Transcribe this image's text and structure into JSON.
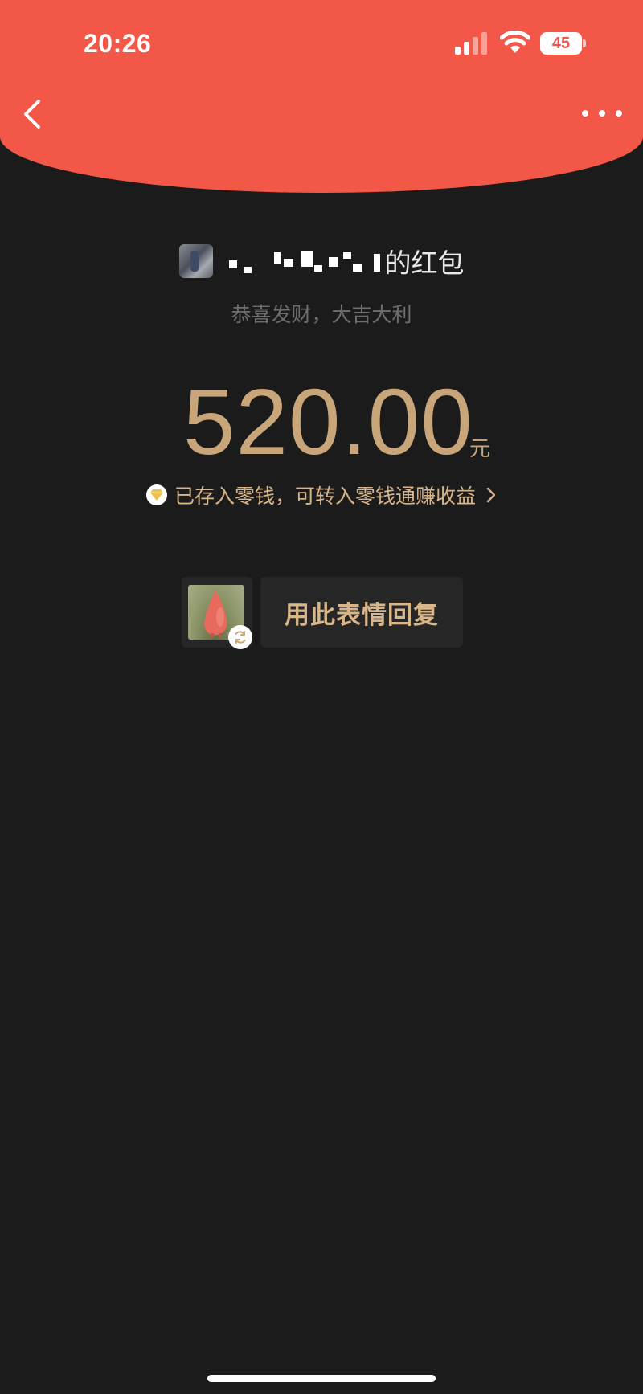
{
  "status_bar": {
    "time": "20:26",
    "battery_level": "45"
  },
  "nav": {
    "back_icon": "chevron-left-icon",
    "more_icon": "more-dots-icon"
  },
  "envelope": {
    "sender_suffix": "的红包",
    "blessing": "恭喜发财，大吉大利",
    "amount": "520.00",
    "unit": "元",
    "change_notice": "已存入零钱，可转入零钱通赚收益",
    "reply_label": "用此表情回复"
  },
  "colors": {
    "banner_red": "#f25747",
    "background": "#1b1b1b",
    "gold": "#c9a67a",
    "light_gold": "#d9b58a"
  }
}
